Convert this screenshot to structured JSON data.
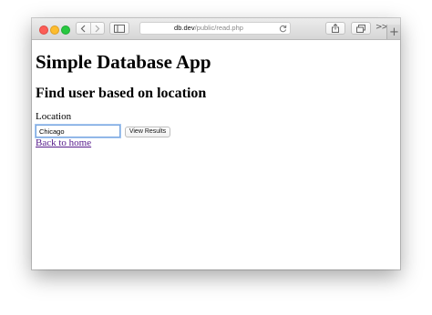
{
  "browser": {
    "url_host": "db.dev",
    "url_path": "/public/read.php",
    "more_label": ">>",
    "new_tab_label": "+"
  },
  "page": {
    "title": "Simple Database App",
    "subtitle": "Find user based on location",
    "form": {
      "location_label": "Location",
      "location_value": "Chicago",
      "submit_label": "View Results"
    },
    "back_link": "Back to home"
  }
}
